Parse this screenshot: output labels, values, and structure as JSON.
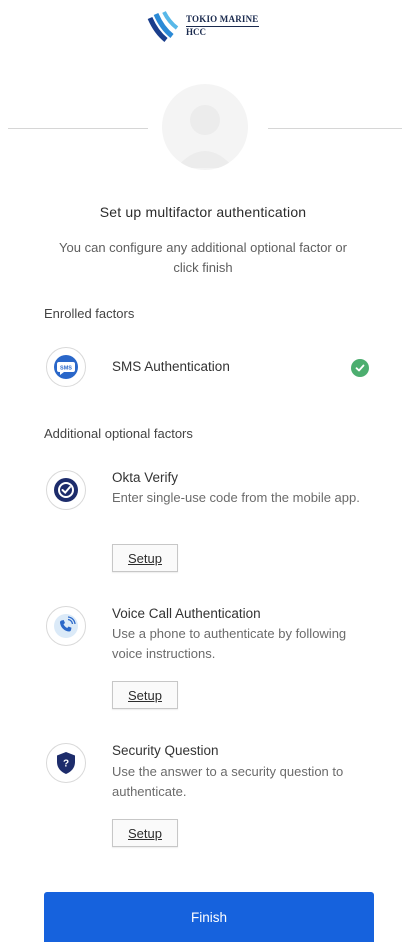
{
  "brand": {
    "line1": "TOKIO MARINE",
    "line2": "HCC",
    "color": "#1a2a4e"
  },
  "header": {
    "title": "Set up multifactor authentication",
    "subtitle": "You can configure any additional optional factor or click finish"
  },
  "enrolled": {
    "label": "Enrolled factors",
    "items": [
      {
        "name": "SMS Authentication",
        "icon": "sms-icon",
        "icon_text": "SMS",
        "status_icon": "check-circle-icon"
      }
    ]
  },
  "optional": {
    "label": "Additional optional factors",
    "items": [
      {
        "name": "Okta Verify",
        "description": "Enter single-use code from the mobile app.",
        "icon": "okta-verify-icon",
        "button": "Setup"
      },
      {
        "name": "Voice Call Authentication",
        "description": "Use a phone to authenticate by following voice instructions.",
        "icon": "phone-call-icon",
        "button": "Setup"
      },
      {
        "name": "Security Question",
        "description": "Use the answer to a security question to authenticate.",
        "icon": "shield-question-icon",
        "icon_text": "?",
        "button": "Setup"
      }
    ]
  },
  "finish_label": "Finish",
  "colors": {
    "primary": "#1662dd",
    "success": "#4cae6f",
    "icon_blue": "#2a67c9"
  }
}
